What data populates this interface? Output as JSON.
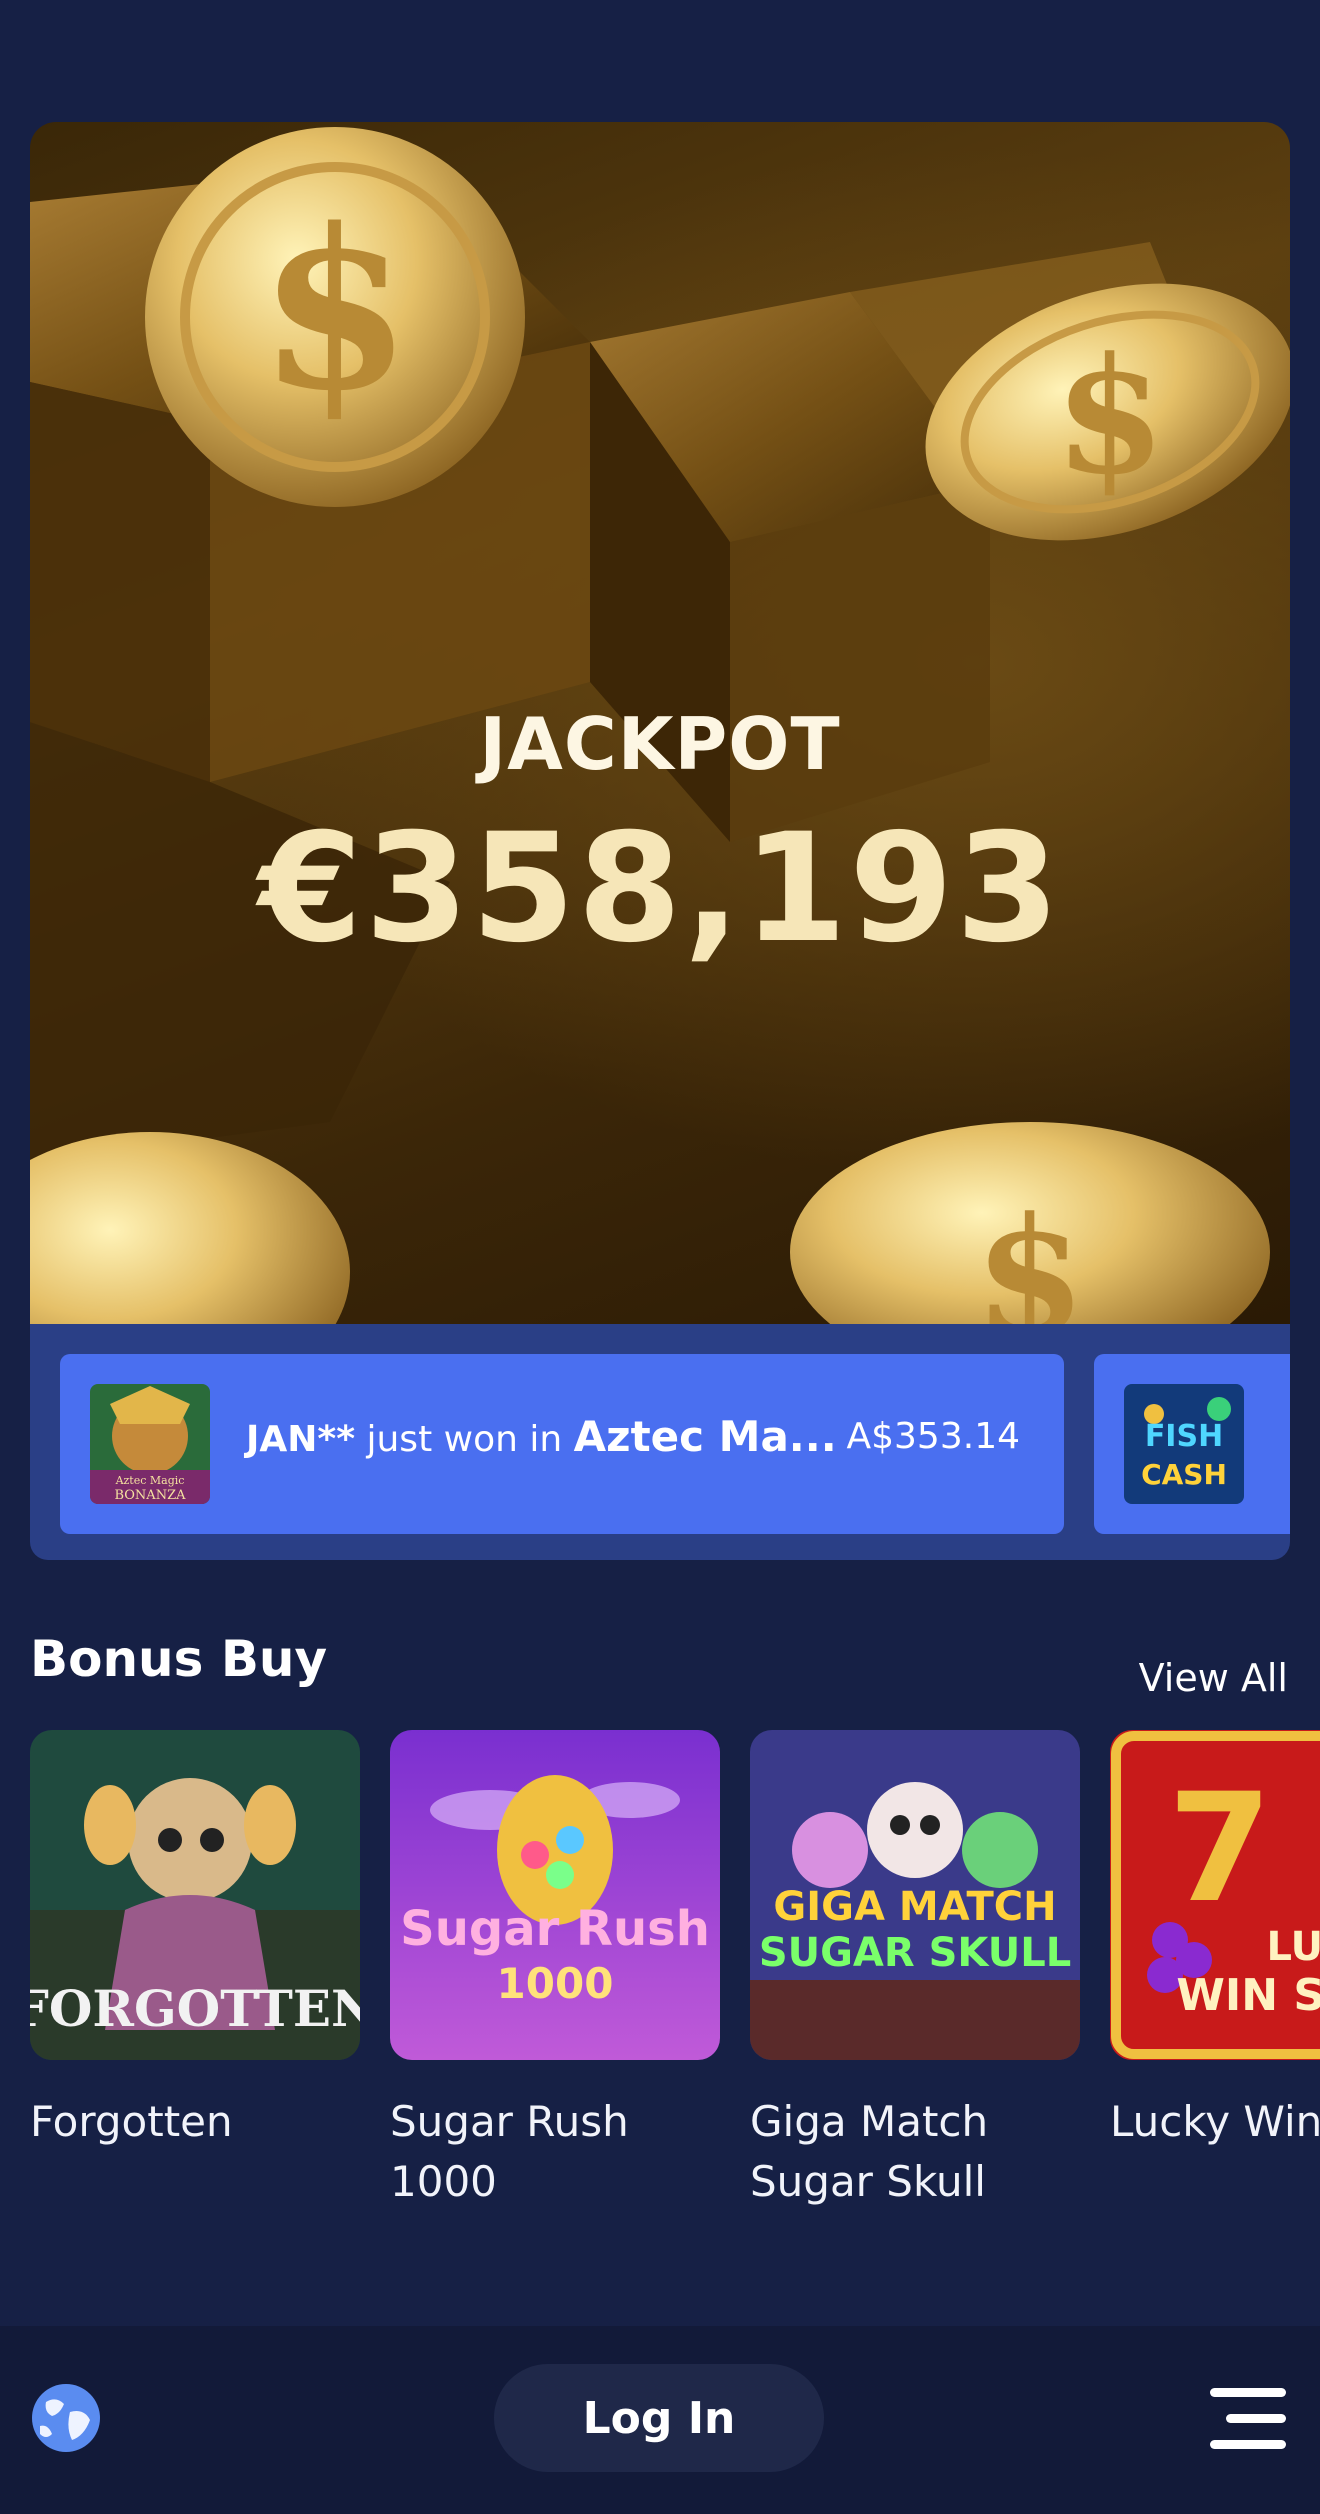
{
  "jackpot": {
    "label": "JACKPOT",
    "amount": "€358,193"
  },
  "ticker": {
    "items": [
      {
        "user": "JAN**",
        "text": " just won in ",
        "game": "Aztec Ma...",
        "amount": "A$353.14",
        "thumb_caption_1": "Aztec Magic",
        "thumb_caption_2": "BONANZA"
      },
      {
        "thumb_caption_1": "FISH",
        "thumb_caption_2": "CASH"
      }
    ]
  },
  "bonus_buy": {
    "title": "Bonus Buy",
    "view_all": "View All",
    "games": [
      {
        "name": "Forgotten",
        "tile_text": "FORGOTTEN"
      },
      {
        "name": "Sugar Rush 1000",
        "tile_text_1": "Sugar Rush",
        "tile_text_2": "1000"
      },
      {
        "name": "Giga Match Sugar Skull",
        "tile_text_1": "GIGA MATCH",
        "tile_text_2": "SUGAR SKULL"
      },
      {
        "name": "Lucky Win X",
        "tile_text_1": "LUCK",
        "tile_text_2": "WIN SPI"
      }
    ]
  },
  "bottom_bar": {
    "login_label": "Log In",
    "globe_icon": "globe-icon",
    "menu_icon": "hamburger-menu-icon"
  },
  "colors": {
    "background": "#162045",
    "ticker_bg": "#2a3f86",
    "win_card": "#4a6ff0",
    "jackpot_text": "#f6e6b8"
  }
}
